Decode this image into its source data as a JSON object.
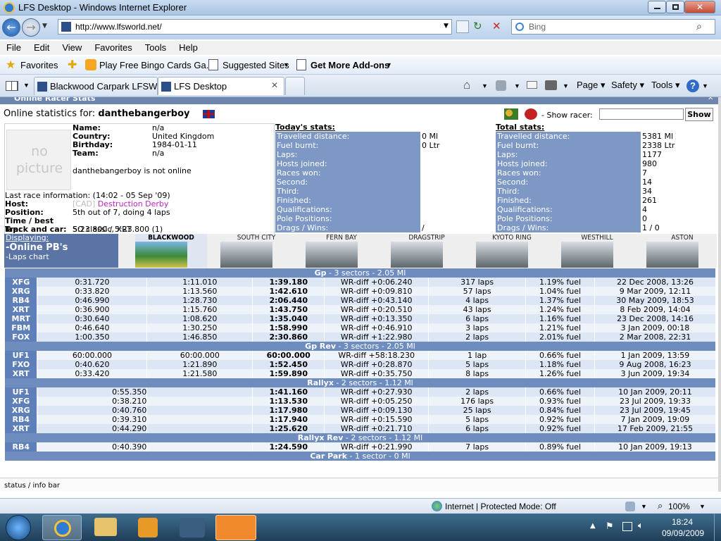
{
  "window": {
    "title": "LFS Desktop - Windows Internet Explorer"
  },
  "address": {
    "url": "http://www.lfsworld.net/",
    "search_placeholder": "Bing"
  },
  "menu": [
    "File",
    "Edit",
    "View",
    "Favorites",
    "Tools",
    "Help"
  ],
  "favorites_bar": {
    "favorites_label": "Favorites",
    "items": [
      "Play Free Bingo Cards Ga...",
      "Suggested Sites",
      "Get More Add-ons"
    ]
  },
  "tabs": [
    {
      "label": "Blackwood Carpark LFSW - ..."
    },
    {
      "label": "LFS Desktop"
    }
  ],
  "command_bar": {
    "page": "Page",
    "safety": "Safety",
    "tools": "Tools"
  },
  "panel_title": "Online Racer Stats",
  "racer": {
    "heading_prefix": "Online statistics for:",
    "name": "danthebangerboy",
    "show_racer_label": "- Show racer:",
    "show_button": "Show",
    "no_picture": "no picture",
    "fields": [
      {
        "label": "Name:",
        "value": "n/a"
      },
      {
        "label": "Country:",
        "value": "United Kingdom"
      },
      {
        "label": "Birthday:",
        "value": "1984-01-11"
      },
      {
        "label": "Team:",
        "value": "n/a"
      }
    ],
    "online_status": "danthebangerboy is not online",
    "last_race_info": "Last race information: (14:02 - 05 Sep '09)",
    "host_label": "Host:",
    "host_tag": "[CAD]",
    "host_name": "Destruction Derby",
    "position_label": "Position:",
    "position_value": "5th out of 7, doing 4 laps",
    "lap_label": "Time / best lap:",
    "lap_value": "5:23.800 / 5:23.800 (1)",
    "track_label": "Track and car:",
    "track_value": "SO classic, XRT"
  },
  "todays_stats": {
    "title": "Today's stats:",
    "rows": [
      {
        "label": "Travelled distance:",
        "value": "0 Ml"
      },
      {
        "label": "Fuel burnt:",
        "value": "0 Ltr"
      },
      {
        "label": "Laps:",
        "value": ""
      },
      {
        "label": "Hosts joined:",
        "value": ""
      },
      {
        "label": "Races won:",
        "value": ""
      },
      {
        "label": "Second:",
        "value": ""
      },
      {
        "label": "Third:",
        "value": ""
      },
      {
        "label": "Finished:",
        "value": ""
      },
      {
        "label": "Qualifications:",
        "value": ""
      },
      {
        "label": "Pole Positions:",
        "value": ""
      },
      {
        "label": "Drags / Wins:",
        "value": "/"
      }
    ]
  },
  "total_stats": {
    "title": "Total stats:",
    "rows": [
      {
        "label": "Travelled distance:",
        "value": "5381 Ml"
      },
      {
        "label": "Fuel burnt:",
        "value": "2338 Ltr"
      },
      {
        "label": "Laps:",
        "value": "1177"
      },
      {
        "label": "Hosts joined:",
        "value": "980"
      },
      {
        "label": "Races won:",
        "value": "7"
      },
      {
        "label": "Second:",
        "value": "14"
      },
      {
        "label": "Third:",
        "value": "34"
      },
      {
        "label": "Finished:",
        "value": "261"
      },
      {
        "label": "Qualifications:",
        "value": "4"
      },
      {
        "label": "Pole Positions:",
        "value": "0"
      },
      {
        "label": "Drags / Wins:",
        "value": "1 / 0"
      }
    ]
  },
  "display_menu": {
    "title": "Displaying:",
    "active": "-Online PB's",
    "other": "-Laps chart"
  },
  "tracks": [
    "BLACKWOOD",
    "SOUTH CITY",
    "FERN BAY",
    "DRAGSTRIP",
    "KYOTO RING",
    "WESTHILL",
    "ASTON"
  ],
  "results": [
    {
      "section": "Gp",
      "desc": " - 3 sectors - 2.05 Ml",
      "indent": false,
      "rows": [
        [
          "XFG",
          "0:31.720",
          "1:11.010",
          "1:39.180",
          "WR-diff +0:06.240",
          "317 laps",
          "1.19% fuel",
          "22 Dec 2008, 13:26"
        ],
        [
          "XRG",
          "0:33.820",
          "1:13.560",
          "1:42.610",
          "WR-diff +0:09.810",
          "57 laps",
          "1.04% fuel",
          "9 Mar 2009, 12:11"
        ],
        [
          "RB4",
          "0:46.990",
          "1:28.730",
          "2:06.440",
          "WR-diff +0:43.140",
          "4 laps",
          "1.37% fuel",
          "30 May 2009, 18:53"
        ],
        [
          "XRT",
          "0:36.900",
          "1:15.760",
          "1:43.750",
          "WR-diff +0:20.510",
          "43 laps",
          "1.24% fuel",
          "8 Feb 2009, 14:04"
        ],
        [
          "MRT",
          "0:30.640",
          "1:08.620",
          "1:35.040",
          "WR-diff +0:13.350",
          "6 laps",
          "1.16% fuel",
          "23 Dec 2008, 14:16"
        ],
        [
          "FBM",
          "0:46.640",
          "1:30.250",
          "1:58.990",
          "WR-diff +0:46.910",
          "3 laps",
          "1.21% fuel",
          "3 Jan 2009, 00:18"
        ],
        [
          "FOX",
          "1:00.350",
          "1:46.850",
          "2:30.860",
          "WR-diff +1:22.980",
          "2 laps",
          "2.01% fuel",
          "2 Mar 2008, 22:31"
        ]
      ]
    },
    {
      "section": "Gp Rev",
      "desc": " - 3 sectors - 2.05 Ml",
      "indent": false,
      "rows": [
        [
          "UF1",
          "60:00.000",
          "60:00.000",
          "60:00.000",
          "WR-diff +58:18.230",
          "1 lap",
          "0.66% fuel",
          "1 Jan 2009, 13:59"
        ],
        [
          "FXO",
          "0:40.620",
          "1:21.890",
          "1:52.450",
          "WR-diff +0:28.870",
          "5 laps",
          "1.18% fuel",
          "9 Aug 2008, 16:23"
        ],
        [
          "XRT",
          "0:33.420",
          "1:21.580",
          "1:59.890",
          "WR-diff +0:35.750",
          "8 laps",
          "1.26% fuel",
          "3 Jun 2009, 19:34"
        ]
      ]
    },
    {
      "section": "Rallyx",
      "desc": " - 2 sectors - 1.12 Ml",
      "indent": true,
      "rows": [
        [
          "UF1",
          "0:55.350",
          "",
          "1:41.160",
          "WR-diff +0:27.930",
          "2 laps",
          "0.66% fuel",
          "10 Jan 2009, 20:11"
        ],
        [
          "XFG",
          "0:38.210",
          "",
          "1:13.530",
          "WR-diff +0:05.250",
          "176 laps",
          "0.93% fuel",
          "23 Jul 2009, 19:33"
        ],
        [
          "XRG",
          "0:40.760",
          "",
          "1:17.980",
          "WR-diff +0:09.130",
          "25 laps",
          "0.84% fuel",
          "23 Jul 2009, 19:45"
        ],
        [
          "RB4",
          "0:39.310",
          "",
          "1:17.940",
          "WR-diff +0:15.590",
          "5 laps",
          "0.92% fuel",
          "7 Jan 2009, 19:09"
        ],
        [
          "XRT",
          "0:44.290",
          "",
          "1:25.620",
          "WR-diff +0:21.710",
          "6 laps",
          "0.92% fuel",
          "17 Feb 2009, 21:55"
        ]
      ]
    },
    {
      "section": "Rallyx Rev",
      "desc": " - 2 sectors - 1.12 Ml",
      "indent": true,
      "rows": [
        [
          "RB4",
          "0:40.390",
          "",
          "1:24.590",
          "WR-diff +0:21.990",
          "7 laps",
          "0.89% fuel",
          "10 Jan 2009, 19:13"
        ]
      ]
    },
    {
      "section": "Car Park",
      "desc": " - 1 sector - 0 Ml",
      "indent": true,
      "rows": []
    }
  ],
  "page_status_bar": "status / info bar",
  "ie_status": {
    "zone": "Internet | Protected Mode: Off",
    "zoom": "100%"
  },
  "taskbar": {
    "time": "18:24",
    "date": "09/09/2009"
  }
}
